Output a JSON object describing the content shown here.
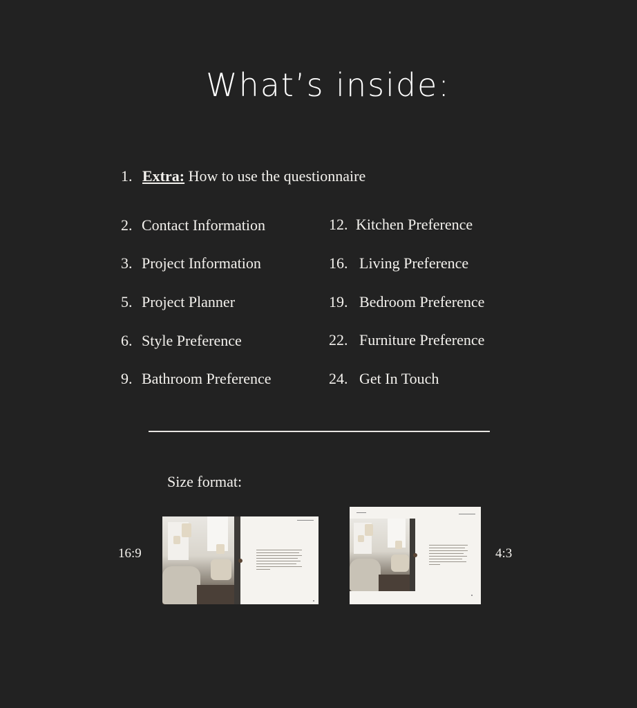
{
  "title": "What’s inside:",
  "intro_item": {
    "num": "1.",
    "extra_label": "Extra:",
    "label": "How to use the questionnaire"
  },
  "left_items": [
    {
      "num": "2.",
      "label": "Contact Information"
    },
    {
      "num": "3.",
      "label": "Project Information"
    },
    {
      "num": "5.",
      "label": "Project Planner"
    },
    {
      "num": "6.",
      "label": "Style Preference"
    },
    {
      "num": "9.",
      "label": "Bathroom Preference"
    }
  ],
  "right_items": [
    {
      "num": "12.",
      "label": "Kitchen Preference"
    },
    {
      "num": "16.",
      "label": "Living Preference"
    },
    {
      "num": "19.",
      "label": "Bedroom Preference"
    },
    {
      "num": "22.",
      "label": "Furniture Preference"
    },
    {
      "num": "24.",
      "label": "Get In Touch"
    }
  ],
  "size_format": {
    "title": "Size format:",
    "wide_label": "16:9",
    "standard_label": "4:3"
  },
  "colors": {
    "background": "#222222",
    "text": "#f4f2ee",
    "page": "#f5f3ef",
    "accent_dot": "#5a4535"
  }
}
